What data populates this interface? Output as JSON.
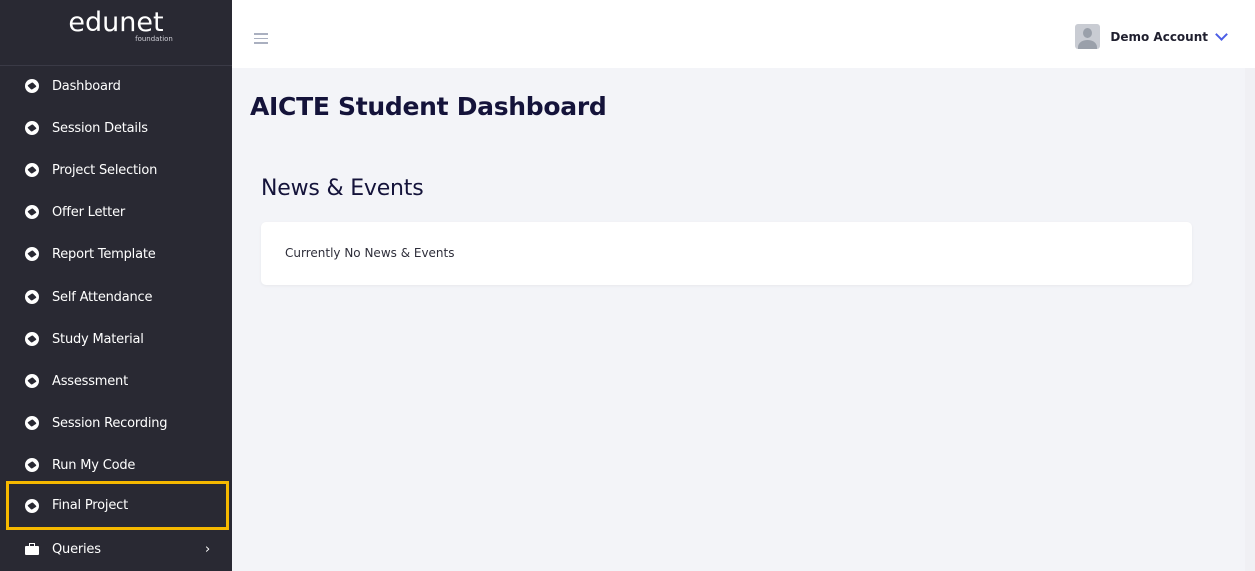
{
  "brand": {
    "logo": "edunet",
    "sub": "foundation"
  },
  "sidebar": {
    "items": [
      {
        "label": "Dashboard"
      },
      {
        "label": "Session Details"
      },
      {
        "label": "Project Selection"
      },
      {
        "label": "Offer Letter"
      },
      {
        "label": "Report Template"
      },
      {
        "label": "Self Attendance"
      },
      {
        "label": "Study Material"
      },
      {
        "label": "Assessment"
      },
      {
        "label": "Session Recording"
      },
      {
        "label": "Run My Code"
      },
      {
        "label": "Final Project"
      },
      {
        "label": "Queries"
      }
    ]
  },
  "header": {
    "account_name": "Demo Account"
  },
  "main": {
    "title": "AICTE Student Dashboard",
    "news_title": "News & Events",
    "news_empty": "Currently No News & Events"
  },
  "colors": {
    "sidebar_bg": "#292933",
    "highlight": "#f5b800",
    "accent": "#4c5ee6",
    "title": "#14133a"
  }
}
